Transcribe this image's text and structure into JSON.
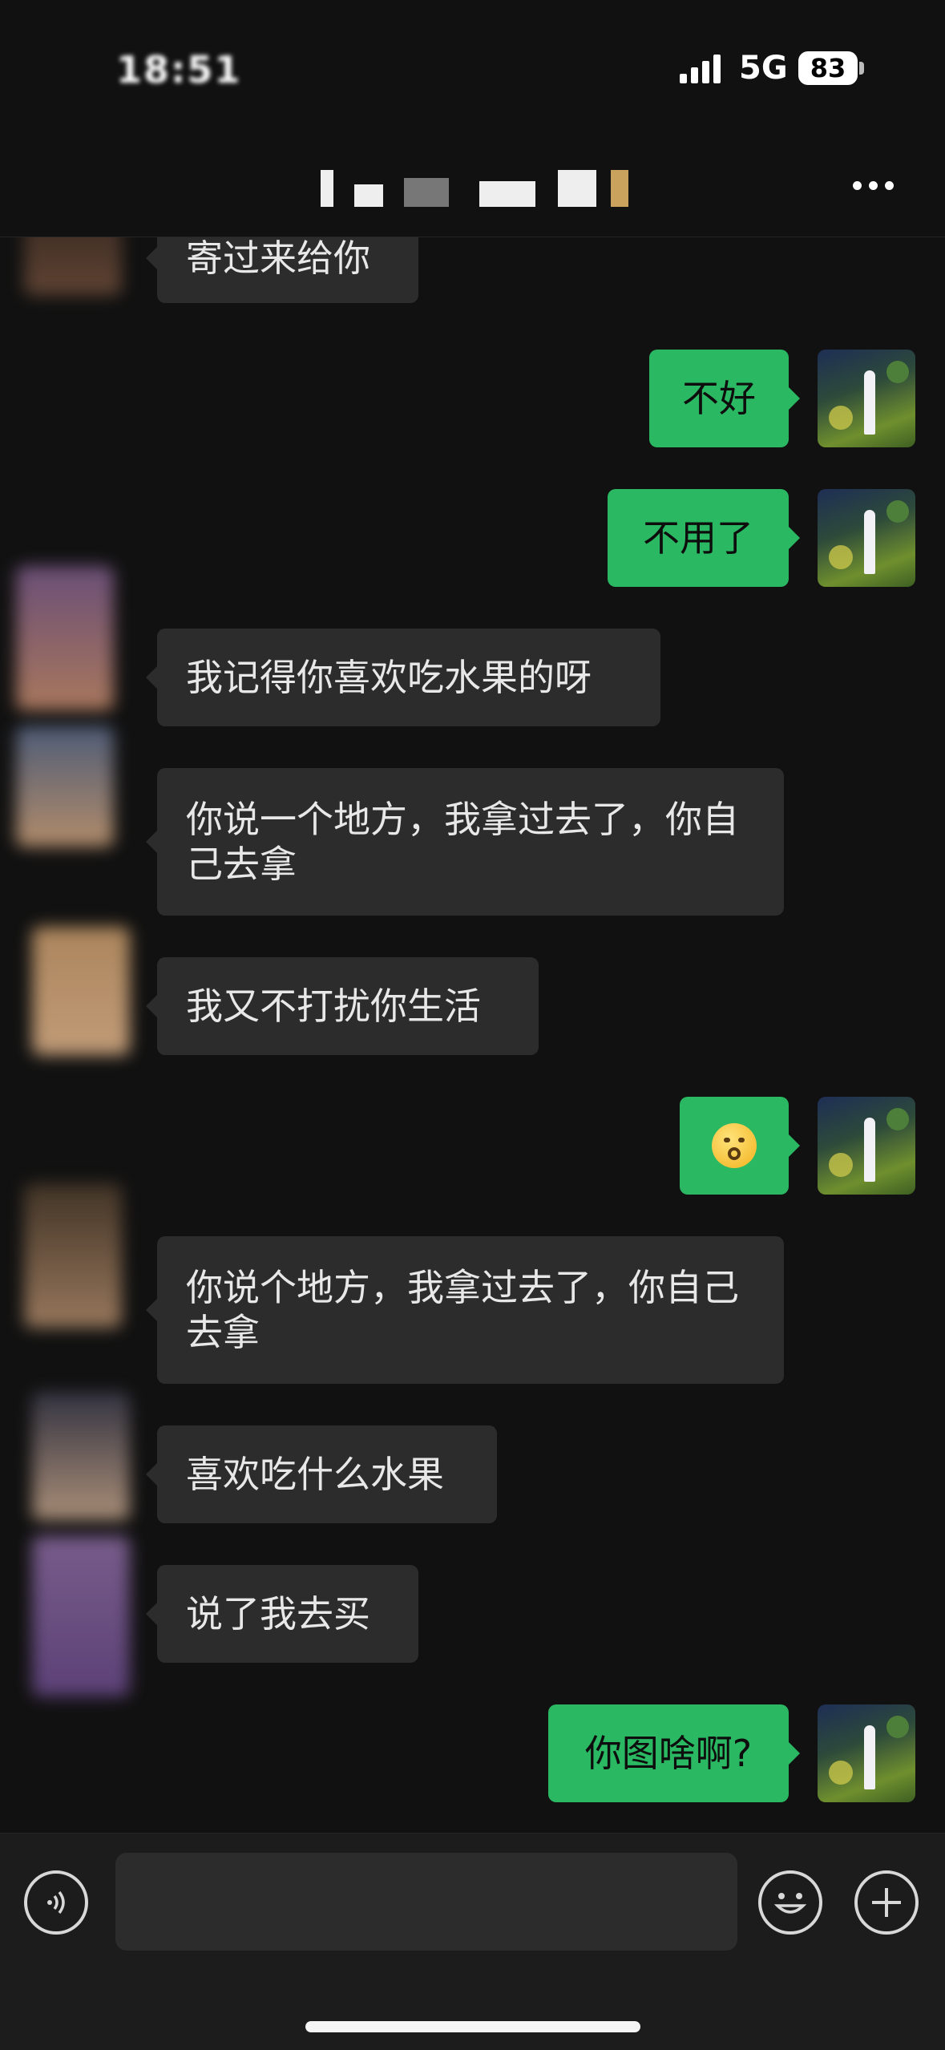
{
  "status_bar": {
    "time": "18:51",
    "network": "5G",
    "battery": "83"
  },
  "header": {
    "title": ""
  },
  "messages": [
    {
      "side": "in",
      "text": "寄过来给你"
    },
    {
      "side": "out",
      "text": "不好"
    },
    {
      "side": "out",
      "text": "不用了"
    },
    {
      "side": "in",
      "text": "我记得你喜欢吃水果的呀"
    },
    {
      "side": "in",
      "text": "你说一个地方，我拿过去了，你自己去拿"
    },
    {
      "side": "in",
      "text": "我又不打扰你生活"
    },
    {
      "side": "out",
      "text": "",
      "emoji": "hushed-face-emoji"
    },
    {
      "side": "in",
      "text": "你说个地方，我拿过去了，你自己去拿"
    },
    {
      "side": "in",
      "text": "喜欢吃什么水果"
    },
    {
      "side": "in",
      "text": "说了我去买"
    },
    {
      "side": "out",
      "text": "你图啥啊?"
    }
  ],
  "input_bar": {
    "placeholder": ""
  },
  "colors": {
    "background": "#111111",
    "bubble_in": "#2c2c2c",
    "bubble_out": "#2ab863"
  }
}
